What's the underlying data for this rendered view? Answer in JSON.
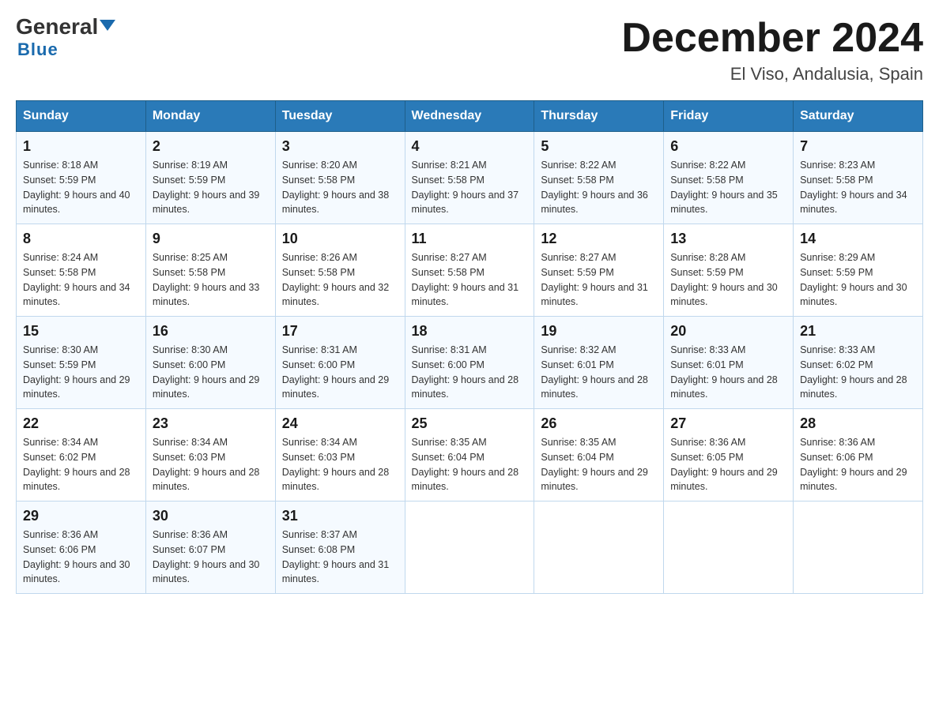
{
  "header": {
    "logo_general": "General",
    "logo_blue": "Blue",
    "month_year": "December 2024",
    "location": "El Viso, Andalusia, Spain"
  },
  "days_of_week": [
    "Sunday",
    "Monday",
    "Tuesday",
    "Wednesday",
    "Thursday",
    "Friday",
    "Saturday"
  ],
  "weeks": [
    [
      {
        "day": "1",
        "sunrise": "8:18 AM",
        "sunset": "5:59 PM",
        "daylight": "9 hours and 40 minutes."
      },
      {
        "day": "2",
        "sunrise": "8:19 AM",
        "sunset": "5:59 PM",
        "daylight": "9 hours and 39 minutes."
      },
      {
        "day": "3",
        "sunrise": "8:20 AM",
        "sunset": "5:58 PM",
        "daylight": "9 hours and 38 minutes."
      },
      {
        "day": "4",
        "sunrise": "8:21 AM",
        "sunset": "5:58 PM",
        "daylight": "9 hours and 37 minutes."
      },
      {
        "day": "5",
        "sunrise": "8:22 AM",
        "sunset": "5:58 PM",
        "daylight": "9 hours and 36 minutes."
      },
      {
        "day": "6",
        "sunrise": "8:22 AM",
        "sunset": "5:58 PM",
        "daylight": "9 hours and 35 minutes."
      },
      {
        "day": "7",
        "sunrise": "8:23 AM",
        "sunset": "5:58 PM",
        "daylight": "9 hours and 34 minutes."
      }
    ],
    [
      {
        "day": "8",
        "sunrise": "8:24 AM",
        "sunset": "5:58 PM",
        "daylight": "9 hours and 34 minutes."
      },
      {
        "day": "9",
        "sunrise": "8:25 AM",
        "sunset": "5:58 PM",
        "daylight": "9 hours and 33 minutes."
      },
      {
        "day": "10",
        "sunrise": "8:26 AM",
        "sunset": "5:58 PM",
        "daylight": "9 hours and 32 minutes."
      },
      {
        "day": "11",
        "sunrise": "8:27 AM",
        "sunset": "5:58 PM",
        "daylight": "9 hours and 31 minutes."
      },
      {
        "day": "12",
        "sunrise": "8:27 AM",
        "sunset": "5:59 PM",
        "daylight": "9 hours and 31 minutes."
      },
      {
        "day": "13",
        "sunrise": "8:28 AM",
        "sunset": "5:59 PM",
        "daylight": "9 hours and 30 minutes."
      },
      {
        "day": "14",
        "sunrise": "8:29 AM",
        "sunset": "5:59 PM",
        "daylight": "9 hours and 30 minutes."
      }
    ],
    [
      {
        "day": "15",
        "sunrise": "8:30 AM",
        "sunset": "5:59 PM",
        "daylight": "9 hours and 29 minutes."
      },
      {
        "day": "16",
        "sunrise": "8:30 AM",
        "sunset": "6:00 PM",
        "daylight": "9 hours and 29 minutes."
      },
      {
        "day": "17",
        "sunrise": "8:31 AM",
        "sunset": "6:00 PM",
        "daylight": "9 hours and 29 minutes."
      },
      {
        "day": "18",
        "sunrise": "8:31 AM",
        "sunset": "6:00 PM",
        "daylight": "9 hours and 28 minutes."
      },
      {
        "day": "19",
        "sunrise": "8:32 AM",
        "sunset": "6:01 PM",
        "daylight": "9 hours and 28 minutes."
      },
      {
        "day": "20",
        "sunrise": "8:33 AM",
        "sunset": "6:01 PM",
        "daylight": "9 hours and 28 minutes."
      },
      {
        "day": "21",
        "sunrise": "8:33 AM",
        "sunset": "6:02 PM",
        "daylight": "9 hours and 28 minutes."
      }
    ],
    [
      {
        "day": "22",
        "sunrise": "8:34 AM",
        "sunset": "6:02 PM",
        "daylight": "9 hours and 28 minutes."
      },
      {
        "day": "23",
        "sunrise": "8:34 AM",
        "sunset": "6:03 PM",
        "daylight": "9 hours and 28 minutes."
      },
      {
        "day": "24",
        "sunrise": "8:34 AM",
        "sunset": "6:03 PM",
        "daylight": "9 hours and 28 minutes."
      },
      {
        "day": "25",
        "sunrise": "8:35 AM",
        "sunset": "6:04 PM",
        "daylight": "9 hours and 28 minutes."
      },
      {
        "day": "26",
        "sunrise": "8:35 AM",
        "sunset": "6:04 PM",
        "daylight": "9 hours and 29 minutes."
      },
      {
        "day": "27",
        "sunrise": "8:36 AM",
        "sunset": "6:05 PM",
        "daylight": "9 hours and 29 minutes."
      },
      {
        "day": "28",
        "sunrise": "8:36 AM",
        "sunset": "6:06 PM",
        "daylight": "9 hours and 29 minutes."
      }
    ],
    [
      {
        "day": "29",
        "sunrise": "8:36 AM",
        "sunset": "6:06 PM",
        "daylight": "9 hours and 30 minutes."
      },
      {
        "day": "30",
        "sunrise": "8:36 AM",
        "sunset": "6:07 PM",
        "daylight": "9 hours and 30 minutes."
      },
      {
        "day": "31",
        "sunrise": "8:37 AM",
        "sunset": "6:08 PM",
        "daylight": "9 hours and 31 minutes."
      },
      null,
      null,
      null,
      null
    ]
  ]
}
